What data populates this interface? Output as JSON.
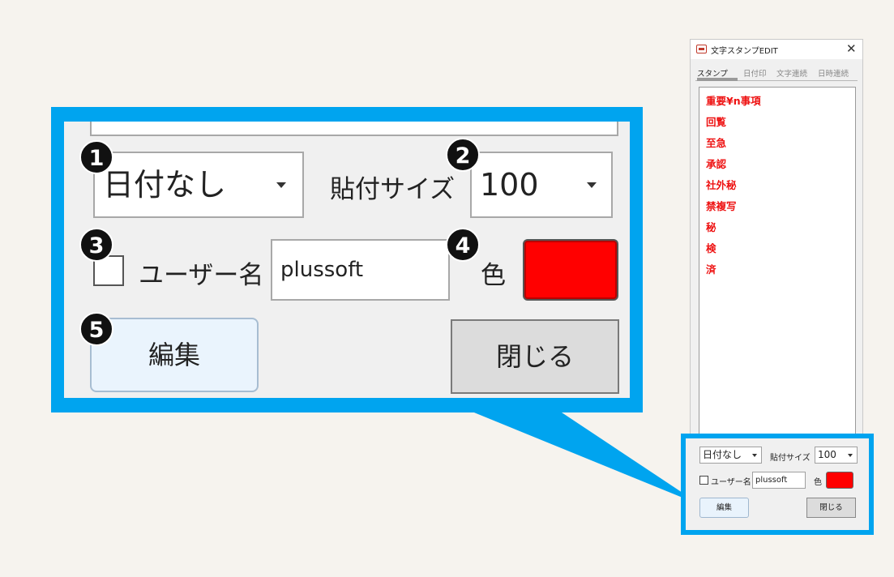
{
  "window": {
    "title": "文字スタンプEDIT",
    "close_glyph": "✕"
  },
  "tabs": [
    {
      "label": "スタンプ",
      "active": true
    },
    {
      "label": "日付印",
      "active": false
    },
    {
      "label": "文字連続",
      "active": false
    },
    {
      "label": "日時連続",
      "active": false
    }
  ],
  "stamps": [
    "重要¥n事項",
    "回覧",
    "至急",
    "承認",
    "社外秘",
    "禁複写",
    "秘",
    "検",
    "済"
  ],
  "stamp_color": "#ee1111",
  "controls": {
    "date_select": "日付なし",
    "paste_size_label": "貼付サイズ",
    "paste_size_value": "100",
    "username_checkbox_label": "ユーザー名",
    "username_checked": false,
    "username_value": "plussoft",
    "color_label": "色",
    "color_value": "#ff0000",
    "edit_button": "編集",
    "close_button": "閉じる"
  },
  "callout_numbers": [
    "1",
    "2",
    "3",
    "4",
    "5"
  ],
  "accent_color": "#00a4ef"
}
